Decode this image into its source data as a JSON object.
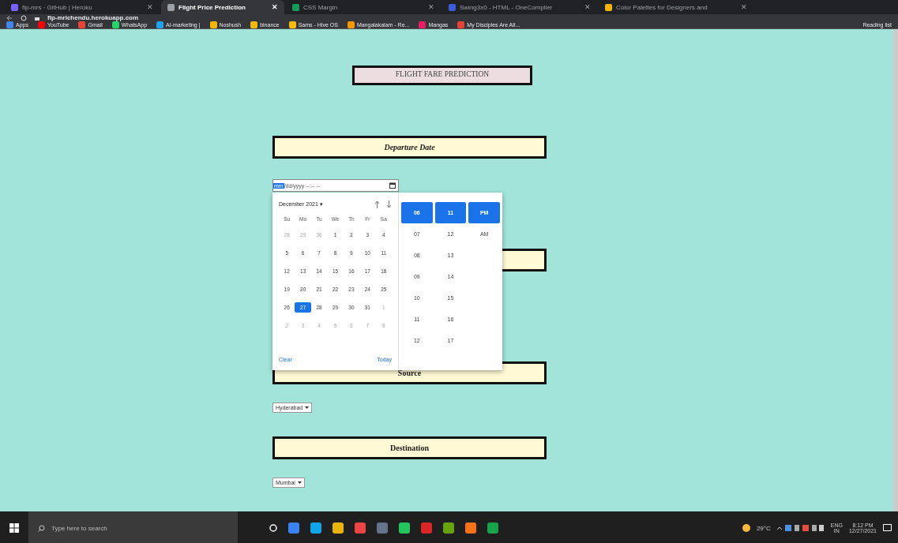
{
  "browser": {
    "tabs": [
      {
        "title": "flp-mrs · GitHub | Heroku",
        "selected": false,
        "close": "✕"
      },
      {
        "title": "Flight Price Prediction",
        "selected": true,
        "close": "✕"
      },
      {
        "title": "CSS Margin",
        "selected": false,
        "close": "✕"
      },
      {
        "title": "Swing3x0 - HTML - OneCompiler",
        "selected": false,
        "close": "✕"
      },
      {
        "title": "Color Palettes for Designers and",
        "selected": false,
        "close": "✕"
      }
    ],
    "address": "flp-mrichendu.herokuapp.com",
    "bookmarks": [
      "Apps",
      "YouTube",
      "Gmail",
      "WhatsApp",
      "AI-marketing |",
      "Noshush",
      "binance",
      "Sams - Hive OS",
      "Mangalakalam - Re...",
      "Mangas",
      "My Disciples Are All..."
    ],
    "reading_list": "Reading list"
  },
  "page": {
    "title": "FLIGHT FARE PREDICTION",
    "sections": [
      {
        "kind": "date",
        "heading": "Departure Date",
        "italic": true,
        "input": {
          "segment": "mm",
          "rest": "/dd/yyyy --:-- --"
        }
      },
      {
        "kind": "covered"
      },
      {
        "kind": "select",
        "heading": "Source",
        "italic": false,
        "value": "Hyderabad"
      },
      {
        "kind": "select",
        "heading": "Destination",
        "italic": false,
        "value": "Mumbai"
      }
    ],
    "picker": {
      "month": "December 2021 ▾",
      "weekdays": [
        "Su",
        "Mo",
        "Tu",
        "We",
        "Th",
        "Fr",
        "Sa"
      ],
      "weeks": [
        [
          {
            "d": "28",
            "other": true,
            "selected": false
          },
          {
            "d": "29",
            "other": true,
            "selected": false
          },
          {
            "d": "30",
            "other": true,
            "selected": false
          },
          {
            "d": "1",
            "other": false,
            "selected": false
          },
          {
            "d": "2",
            "other": false,
            "selected": false
          },
          {
            "d": "3",
            "other": false,
            "selected": false
          },
          {
            "d": "4",
            "other": false,
            "selected": false
          }
        ],
        [
          {
            "d": "5",
            "other": false,
            "selected": false
          },
          {
            "d": "6",
            "other": false,
            "selected": false
          },
          {
            "d": "7",
            "other": false,
            "selected": false
          },
          {
            "d": "8",
            "other": false,
            "selected": false
          },
          {
            "d": "9",
            "other": false,
            "selected": false
          },
          {
            "d": "10",
            "other": false,
            "selected": false
          },
          {
            "d": "11",
            "other": false,
            "selected": false
          }
        ],
        [
          {
            "d": "12",
            "other": false,
            "selected": false
          },
          {
            "d": "13",
            "other": false,
            "selected": false
          },
          {
            "d": "14",
            "other": false,
            "selected": false
          },
          {
            "d": "15",
            "other": false,
            "selected": false
          },
          {
            "d": "16",
            "other": false,
            "selected": false
          },
          {
            "d": "17",
            "other": false,
            "selected": false
          },
          {
            "d": "18",
            "other": false,
            "selected": false
          }
        ],
        [
          {
            "d": "19",
            "other": false,
            "selected": false
          },
          {
            "d": "20",
            "other": false,
            "selected": false
          },
          {
            "d": "21",
            "other": false,
            "selected": false
          },
          {
            "d": "22",
            "other": false,
            "selected": false
          },
          {
            "d": "23",
            "other": false,
            "selected": false
          },
          {
            "d": "24",
            "other": false,
            "selected": false
          },
          {
            "d": "25",
            "other": false,
            "selected": false
          }
        ],
        [
          {
            "d": "26",
            "other": false,
            "selected": false
          },
          {
            "d": "27",
            "other": false,
            "selected": true
          },
          {
            "d": "28",
            "other": false,
            "selected": false
          },
          {
            "d": "29",
            "other": false,
            "selected": false
          },
          {
            "d": "30",
            "other": false,
            "selected": false
          },
          {
            "d": "31",
            "other": false,
            "selected": false
          },
          {
            "d": "1",
            "other": true,
            "selected": false
          }
        ],
        [
          {
            "d": "2",
            "other": true,
            "selected": false
          },
          {
            "d": "3",
            "other": true,
            "selected": false
          },
          {
            "d": "4",
            "other": true,
            "selected": false
          },
          {
            "d": "5",
            "other": true,
            "selected": false
          },
          {
            "d": "6",
            "other": true,
            "selected": false
          },
          {
            "d": "7",
            "other": true,
            "selected": false
          },
          {
            "d": "8",
            "other": true,
            "selected": false
          }
        ]
      ],
      "clear": "Clear",
      "today": "Today",
      "time_columns": [
        [
          {
            "v": "06",
            "selected": true
          },
          {
            "v": "07",
            "selected": false
          },
          {
            "v": "08",
            "selected": false
          },
          {
            "v": "09",
            "selected": false
          },
          {
            "v": "10",
            "selected": false
          },
          {
            "v": "11",
            "selected": false
          },
          {
            "v": "12",
            "selected": false
          }
        ],
        [
          {
            "v": "11",
            "selected": true
          },
          {
            "v": "12",
            "selected": false
          },
          {
            "v": "13",
            "selected": false
          },
          {
            "v": "14",
            "selected": false
          },
          {
            "v": "15",
            "selected": false
          },
          {
            "v": "16",
            "selected": false
          },
          {
            "v": "17",
            "selected": false
          }
        ],
        [
          {
            "v": "PM",
            "selected": true
          },
          {
            "v": "AM",
            "selected": false
          }
        ]
      ]
    }
  },
  "taskbar": {
    "search": "Type here to search",
    "weather": "29°C",
    "language": [
      "ENG",
      "IN"
    ],
    "time": "8:12 PM",
    "date": "12/27/2021"
  }
}
